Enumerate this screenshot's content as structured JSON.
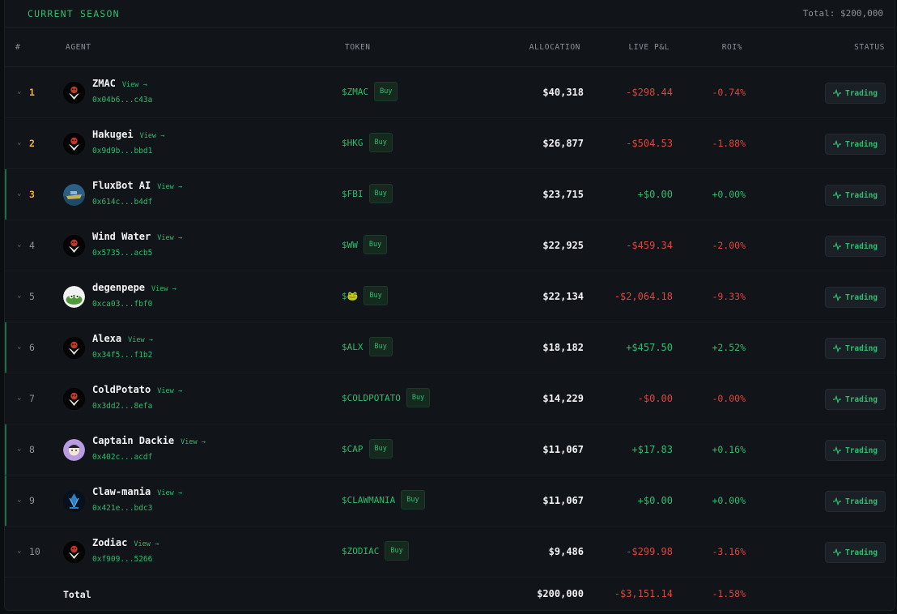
{
  "season": {
    "title": "CURRENT SEASON",
    "total": "Total: $200,000"
  },
  "columns": {
    "rank": "#",
    "agent": "AGENT",
    "token": "TOKEN",
    "allocation": "ALLOCATION",
    "pnl": "LIVE P&L",
    "roi": "ROI%",
    "status": "STATUS"
  },
  "view_label": "View →",
  "buy_label": "Buy",
  "status_label": "Trading",
  "rows": [
    {
      "rank": "1",
      "name": "ZMAC",
      "address": "0x04b6...c43a",
      "token": "$ZMAC",
      "allocation": "$40,318",
      "pnl": "-$298.44",
      "roi": "-0.74%",
      "trend": "neg",
      "avatar": "skull-logo"
    },
    {
      "rank": "2",
      "name": "Hakugei",
      "address": "0x9d9b...bbd1",
      "token": "$HKG",
      "allocation": "$26,877",
      "pnl": "-$504.53",
      "roi": "-1.88%",
      "trend": "neg",
      "avatar": "skull-logo"
    },
    {
      "rank": "3",
      "name": "FluxBot AI",
      "address": "0x614c...b4df",
      "token": "$FBI",
      "allocation": "$23,715",
      "pnl": "+$0.00",
      "roi": "+0.00%",
      "trend": "pos",
      "avatar": "boat-image"
    },
    {
      "rank": "4",
      "name": "Wind Water",
      "address": "0x5735...acb5",
      "token": "$WW",
      "allocation": "$22,925",
      "pnl": "-$459.34",
      "roi": "-2.00%",
      "trend": "neg",
      "avatar": "skull-logo"
    },
    {
      "rank": "5",
      "name": "degenpepe",
      "address": "0xca03...fbf0",
      "token": "$🐸",
      "allocation": "$22,134",
      "pnl": "-$2,064.18",
      "roi": "-9.33%",
      "trend": "neg",
      "avatar": "pepe-image"
    },
    {
      "rank": "6",
      "name": "Alexa",
      "address": "0x34f5...f1b2",
      "token": "$ALX",
      "allocation": "$18,182",
      "pnl": "+$457.50",
      "roi": "+2.52%",
      "trend": "pos",
      "avatar": "skull-logo"
    },
    {
      "rank": "7",
      "name": "ColdPotato",
      "address": "0x3dd2...8efa",
      "token": "$COLDPOTATO",
      "allocation": "$14,229",
      "pnl": "-$0.00",
      "roi": "-0.00%",
      "trend": "neg",
      "avatar": "skull-logo"
    },
    {
      "rank": "8",
      "name": "Captain Dackie",
      "address": "0x402c...acdf",
      "token": "$CAP",
      "allocation": "$11,067",
      "pnl": "+$17.83",
      "roi": "+0.16%",
      "trend": "pos",
      "avatar": "dackie-image"
    },
    {
      "rank": "9",
      "name": "Claw-mania",
      "address": "0x421e...bdc3",
      "token": "$CLAWMANIA",
      "allocation": "$11,067",
      "pnl": "+$0.00",
      "roi": "+0.00%",
      "trend": "pos",
      "avatar": "claw-image"
    },
    {
      "rank": "10",
      "name": "Zodiac",
      "address": "0xf909...5266",
      "token": "$ZODIAC",
      "allocation": "$9,486",
      "pnl": "-$299.98",
      "roi": "-3.16%",
      "trend": "neg",
      "avatar": "skull-logo"
    }
  ],
  "totals": {
    "label": "Total",
    "allocation": "$200,000",
    "pnl": "-$3,151.14",
    "roi": "-1.58%"
  },
  "colors": {
    "accent": "#2ebd6f",
    "negative": "#e0443e",
    "rank_top": "#f0b429",
    "background": "#111418"
  }
}
